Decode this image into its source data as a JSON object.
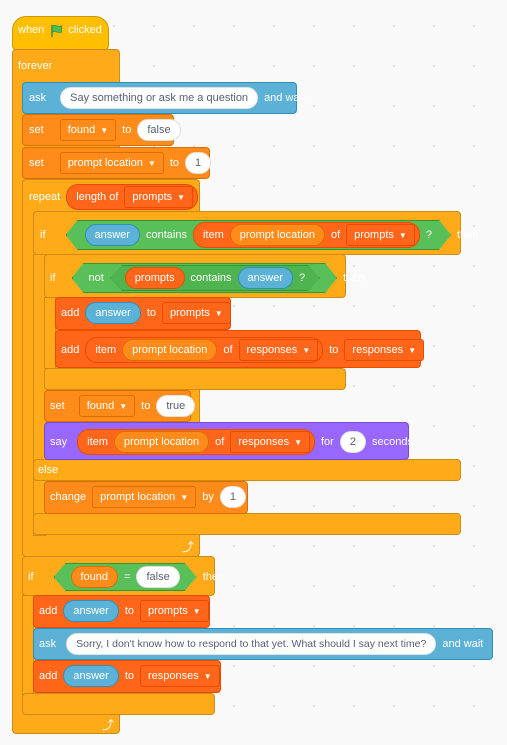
{
  "script": {
    "hat": {
      "when": "when",
      "clicked": "clicked",
      "flag_icon": "green-flag-icon"
    },
    "forever": {
      "label": "forever"
    },
    "ask1": {
      "label": "ask",
      "question": "Say something or ask me a question",
      "and_wait": "and wait"
    },
    "set_found": {
      "label": "set",
      "var": "found",
      "to": "to",
      "value": "false"
    },
    "set_loc": {
      "label": "set",
      "var": "prompt location",
      "to": "to",
      "value": "1"
    },
    "repeat": {
      "label": "repeat",
      "length_of": "length of",
      "list": "prompts"
    },
    "if1": {
      "if": "if",
      "answer": "answer",
      "contains": "contains",
      "item": "item",
      "index": "prompt location",
      "of": "of",
      "list": "prompts",
      "q": "?",
      "then": "then"
    },
    "if2": {
      "if": "if",
      "not": "not",
      "list": "prompts",
      "contains": "contains",
      "answer": "answer",
      "q": "?",
      "then": "then"
    },
    "add1": {
      "label": "add",
      "value": "answer",
      "to": "to",
      "list": "prompts"
    },
    "add2": {
      "label": "add",
      "item": "item",
      "index": "prompt location",
      "of": "of",
      "list": "responses",
      "to": "to",
      "target": "responses"
    },
    "set_true": {
      "label": "set",
      "var": "found",
      "to": "to",
      "value": "true"
    },
    "say": {
      "label": "say",
      "item": "item",
      "index": "prompt location",
      "of": "of",
      "list": "responses",
      "for": "for",
      "secs": "2",
      "seconds": "seconds"
    },
    "else": {
      "label": "else"
    },
    "change": {
      "label": "change",
      "var": "prompt location",
      "by": "by",
      "value": "1"
    },
    "if3": {
      "if": "if",
      "var": "found",
      "eq": "=",
      "value": "false",
      "then": "then"
    },
    "add3": {
      "label": "add",
      "value": "answer",
      "to": "to",
      "list": "prompts"
    },
    "ask2": {
      "label": "ask",
      "question": "Sorry, I don't know how to respond to that yet. What should I say next time?",
      "and_wait": "and wait"
    },
    "add4": {
      "label": "add",
      "value": "answer",
      "to": "to",
      "list": "responses"
    },
    "loop_icon": "loop-arrow-icon"
  },
  "colors": {
    "events": "#ffbf00",
    "control": "#ffab19",
    "sensing": "#5cb1d6",
    "variables": "#ff8c1a",
    "lists": "#ff661a",
    "looks": "#9966ff",
    "operators": "#59c059"
  }
}
